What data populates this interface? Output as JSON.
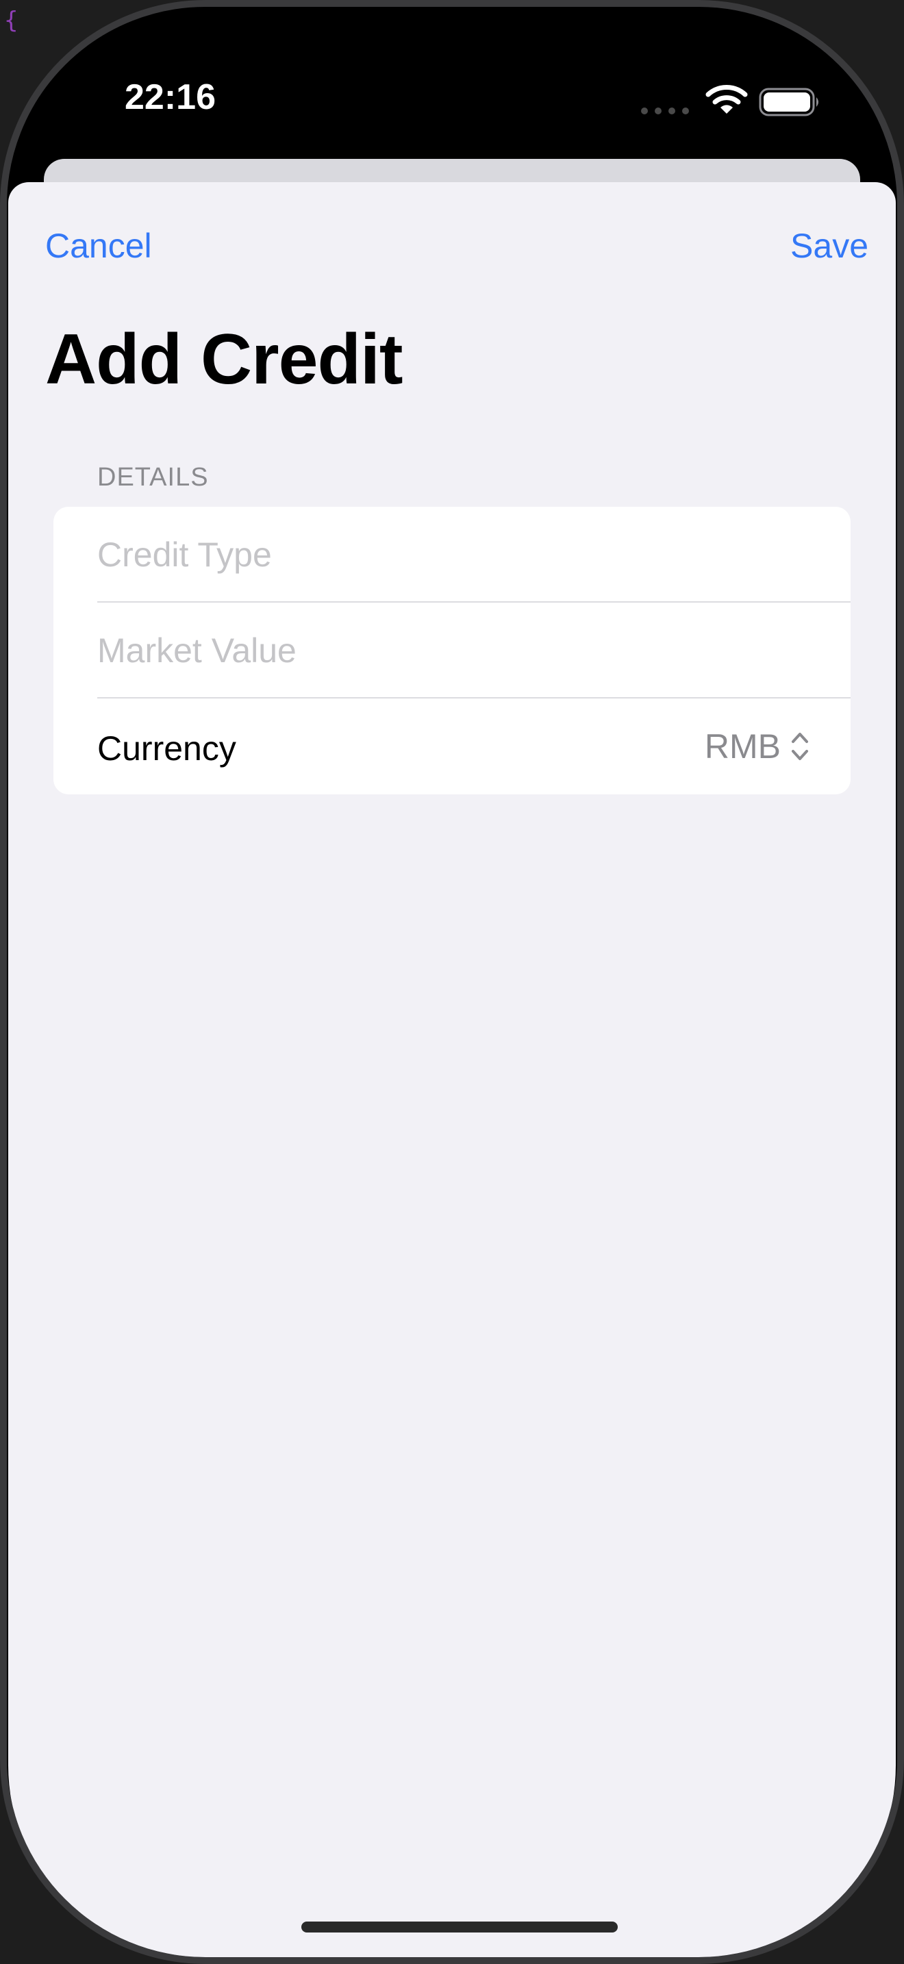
{
  "status_bar": {
    "time": "22:16"
  },
  "navigation": {
    "cancel_label": "Cancel",
    "save_label": "Save",
    "title": "Add Credit",
    "accent_color": "#3478f6"
  },
  "form": {
    "section_header": "DETAILS",
    "fields": [
      {
        "placeholder": "Credit Type",
        "value": ""
      },
      {
        "placeholder": "Market Value",
        "value": ""
      }
    ],
    "currency": {
      "label": "Currency",
      "value": "RMB"
    }
  },
  "icons": {
    "stray_glyph": "{",
    "signal": "cellular-signal-icon",
    "wifi": "wifi-icon",
    "battery": "battery-icon",
    "picker": "chevron-up-down-icon"
  }
}
